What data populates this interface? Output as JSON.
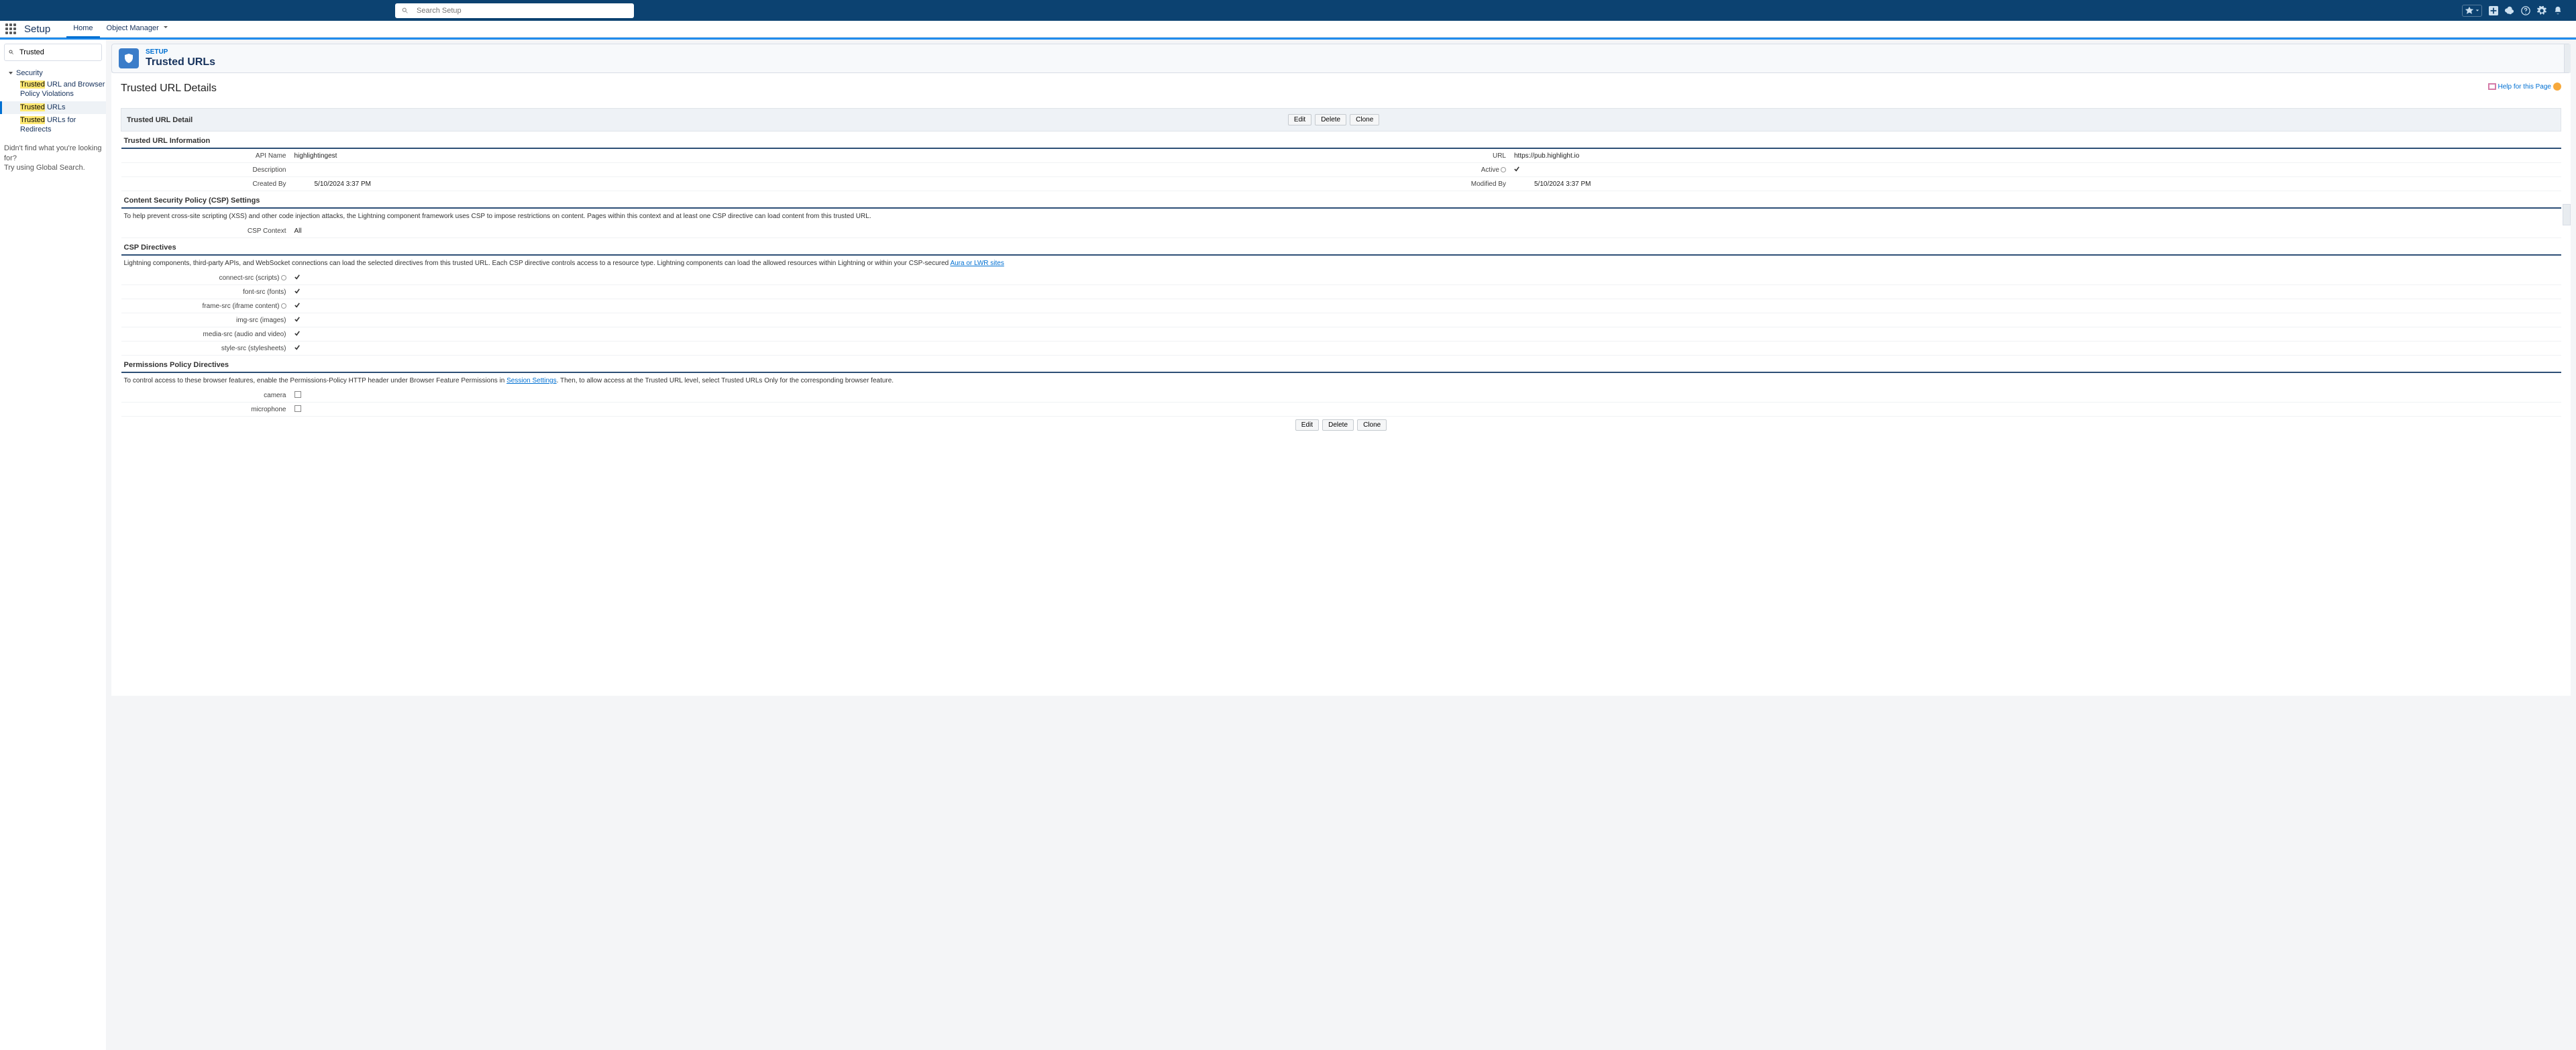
{
  "global": {
    "search_placeholder": "Search Setup",
    "app_name": "Setup",
    "nav": {
      "home": "Home",
      "object_manager": "Object Manager"
    }
  },
  "side": {
    "search_value": "Trusted",
    "root": "Security",
    "items": [
      {
        "pre": "Trusted",
        "rest": " URL and Browser Policy Violations"
      },
      {
        "pre": "Trusted",
        "rest": " URLs"
      },
      {
        "pre": "Trusted",
        "rest": " URLs for Redirects"
      }
    ],
    "foot1": "Didn't find what you're looking for?",
    "foot2": "Try using Global Search."
  },
  "header": {
    "crumb": "SETUP",
    "title": "Trusted URLs"
  },
  "detail": {
    "title": "Trusted URL Details",
    "help_label": "Help for this Page",
    "section_detail": "Trusted URL Detail",
    "btn_edit": "Edit",
    "btn_delete": "Delete",
    "btn_clone": "Clone",
    "info_section": "Trusted URL Information",
    "api_name_label": "API Name",
    "api_name_value": "highlightingest",
    "url_label": "URL",
    "url_value": "https://pub.highlight.io",
    "description_label": "Description",
    "active_label": "Active",
    "created_by_label": "Created By",
    "created_by_value": "5/10/2024 3:37 PM",
    "modified_by_label": "Modified By",
    "modified_by_value": "5/10/2024 3:37 PM",
    "csp_section": "Content Security Policy (CSP) Settings",
    "csp_desc": "To help prevent cross-site scripting (XSS) and other code injection attacks, the Lightning component framework uses CSP to impose restrictions on content. Pages within this context and at least one CSP directive can load content from this trusted URL.",
    "csp_context_label": "CSP Context",
    "csp_context_value": "All",
    "dir_section": "CSP Directives",
    "dir_desc_pre": "Lightning components, third-party APIs, and WebSocket connections can load the selected directives from this trusted URL. Each CSP directive controls access to a resource type. Lightning components can load the allowed resources within Lightning or within your CSP-secured ",
    "dir_desc_link": "Aura or LWR sites",
    "directives": [
      {
        "label": "connect-src (scripts)",
        "info": true
      },
      {
        "label": "font-src (fonts)"
      },
      {
        "label": "frame-src (iframe content)",
        "info": true
      },
      {
        "label": "img-src (images)"
      },
      {
        "label": "media-src (audio and video)"
      },
      {
        "label": "style-src (stylesheets)"
      }
    ],
    "perm_section": "Permissions Policy Directives",
    "perm_desc_pre": "To control access to these browser features, enable the Permissions-Policy HTTP header under Browser Feature Permissions in ",
    "perm_desc_link": "Session Settings",
    "perm_desc_post": ". Then, to allow access at the Trusted URL level, select Trusted URLs Only for the corresponding browser feature.",
    "perm_camera": "camera",
    "perm_microphone": "microphone"
  }
}
